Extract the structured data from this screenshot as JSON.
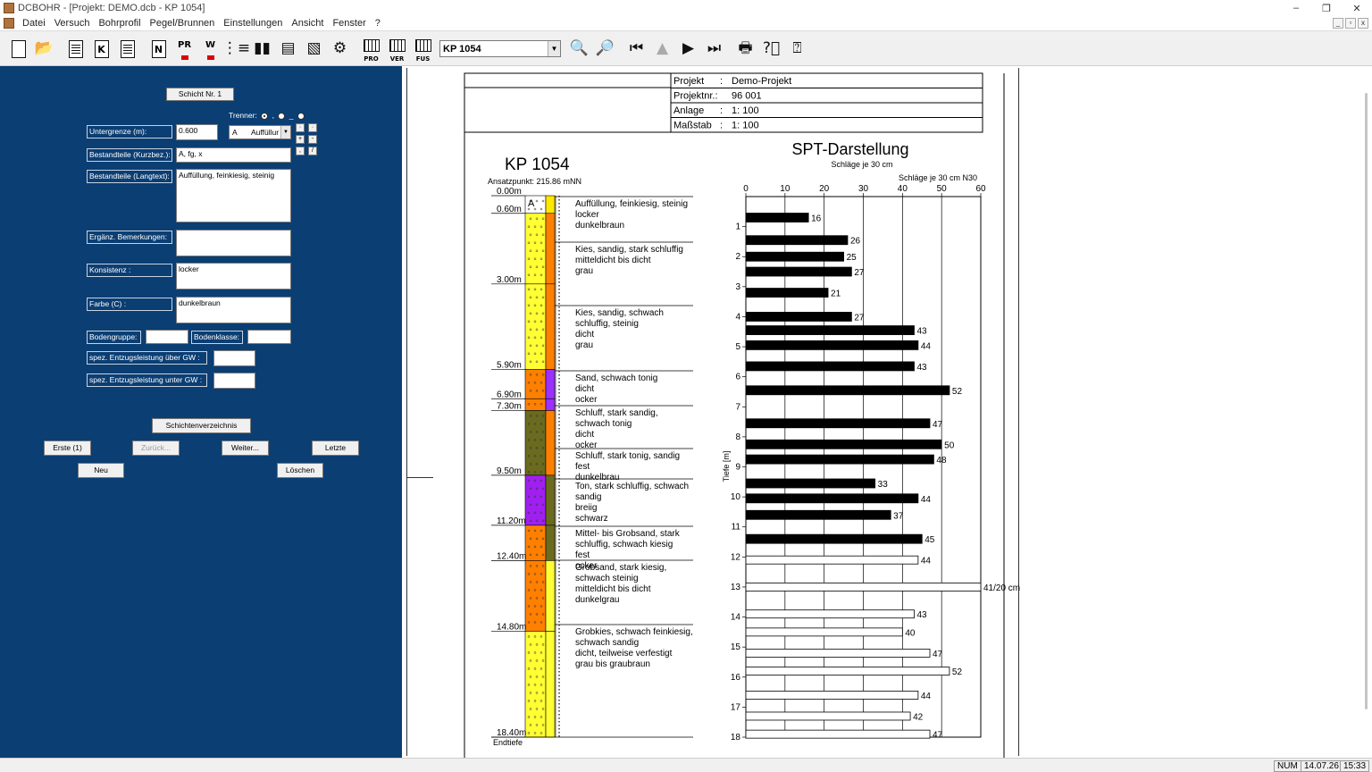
{
  "titlebar": {
    "title": "DCBOHR - [Projekt: DEMO.dcb - KP 1054]",
    "minimize": "–",
    "maximize": "❐",
    "close": "✕"
  },
  "menu": [
    "Datei",
    "Versuch",
    "Bohrprofil",
    "Pegel/Brunnen",
    "Einstellungen",
    "Ansicht",
    "Fenster",
    "?"
  ],
  "mdi_buttons": [
    "_",
    "▫",
    "x"
  ],
  "toolbar": {
    "kp_combo": "KP 1054",
    "btn_pr": "PR",
    "btn_w": "W",
    "btn_n": "N",
    "btn_k": "K",
    "btn_pro": "PRO",
    "btn_ver": "VER",
    "btn_fus": "FUS"
  },
  "form": {
    "schicht_btn": "Schicht Nr.  1",
    "trenner_label": "Trenner:",
    "trenner_opts": [
      ",",
      "_"
    ],
    "untergrenze_label": "Untergrenze        (m):",
    "untergrenze_value": "0.600",
    "bodenart_code": "A",
    "bodenart_name": "Auffüllur",
    "mini_buttons": [
      "·",
      "+",
      "-",
      ",",
      "/",
      "·"
    ],
    "kurzbez_label": "Bestandteile (Kurzbez.):",
    "kurzbez_value": "A, fg, x",
    "langtext_label": "Bestandteile (Langtext):",
    "langtext_value": "Auffüllung, feinkiesig, steinig",
    "bemerkungen_label": "Ergänz. Bemerkungen:",
    "bemerkungen_value": "",
    "konsistenz_label": "Konsistenz           :",
    "konsistenz_value": "locker",
    "farbe_label": "Farbe (C)              :",
    "farbe_value": "dunkelbraun",
    "bodengruppe_label": "Bodengruppe:",
    "bodenklasse_label": "Bodenklasse:",
    "entzug_ueber_label": "spez. Entzugsleistung über GW :",
    "entzug_unter_label": "spez. Entzugsleistung unter GW :",
    "schichtenverzeichnis_btn": "Schichtenverzeichnis",
    "erste_btn": "Erste (1)",
    "zurueck_btn": "Zurück...",
    "weiter_btn": "Weiter...",
    "letzte_btn": "Letzte",
    "neu_btn": "Neu",
    "loeschen_btn": "Löschen"
  },
  "header_table": {
    "rows": [
      {
        "label": "Projekt",
        "sep": ":",
        "value": "Demo-Projekt"
      },
      {
        "label": "Projektnr.:",
        "sep": "",
        "value": "96 001"
      },
      {
        "label": "Anlage",
        "sep": ":",
        "value": "1: 100"
      },
      {
        "label": "Maßstab",
        "sep": ":",
        "value": "1: 100"
      }
    ]
  },
  "profile": {
    "title": "KP 1054",
    "ansatzpunkt": "Ansatzpunkt: 215.86 mNN",
    "endtiefe": "Endtiefe",
    "layer_code_first": "A",
    "depth_labels": [
      {
        "text": "0.00m",
        "depth": 0.0
      },
      {
        "text": "0.60m",
        "depth": 0.6
      },
      {
        "text": "3.00m",
        "depth": 3.0
      },
      {
        "text": "5.90m",
        "depth": 5.9
      },
      {
        "text": "6.90m",
        "depth": 6.9
      },
      {
        "text": "7.30m",
        "depth": 7.3
      },
      {
        "text": "9.50m",
        "depth": 9.5
      },
      {
        "text": "11.20m",
        "depth": 11.2
      },
      {
        "text": "12.40m",
        "depth": 12.4
      },
      {
        "text": "14.80m",
        "depth": 14.8
      },
      {
        "text": "18.40m",
        "depth": 18.4
      }
    ],
    "layers": [
      {
        "top": 0.0,
        "bottom": 0.6,
        "color": "#ffffff",
        "stripe": "#ffe800",
        "lines": [
          "Auffüllung, feinkiesig, steinig",
          "locker",
          "dunkelbraun"
        ]
      },
      {
        "top": 0.6,
        "bottom": 3.0,
        "color": "#ffff33",
        "stripe": "#ff8000",
        "lines": [
          "Kies, sandig, stark schluffig",
          "mitteldicht bis dicht",
          "grau"
        ]
      },
      {
        "top": 3.0,
        "bottom": 5.9,
        "color": "#ffff33",
        "stripe": "#ff8000",
        "lines": [
          "Kies, sandig, schwach",
          "schluffig, steinig",
          "dicht",
          "grau"
        ]
      },
      {
        "top": 5.9,
        "bottom": 6.9,
        "color": "#ff8000",
        "stripe": "#9b30ff",
        "lines": [
          "Sand, schwach tonig",
          "dicht",
          "ocker"
        ]
      },
      {
        "top": 6.9,
        "bottom": 7.3,
        "color": "#ff8000",
        "stripe": "#9b30ff",
        "lines": []
      },
      {
        "top": 7.3,
        "bottom": 9.5,
        "color": "#6b6b1f",
        "stripe": "#ff8000",
        "lines": [
          "Schluff, stark sandig,",
          "schwach tonig",
          "dicht",
          "ocker"
        ]
      },
      {
        "top": 9.5,
        "bottom": 9.5,
        "color": "#6b6b1f",
        "stripe": "#9b30ff",
        "lines": [
          "Schluff, stark tonig, sandig",
          "fest",
          "dunkelbrau"
        ]
      },
      {
        "top": 9.5,
        "bottom": 11.2,
        "color": "#a020f0",
        "stripe": "#6b6b1f",
        "lines": [
          "Ton, stark schluffig, schwach",
          "sandig",
          "breiig",
          "schwarz"
        ]
      },
      {
        "top": 11.2,
        "bottom": 12.4,
        "color": "#ff8000",
        "stripe": "#6b6b1f",
        "lines": [
          "Mittel-  bis Grobsand, stark",
          "schluffig, schwach kiesig",
          "fest",
          "ocker"
        ]
      },
      {
        "top": 12.4,
        "bottom": 14.8,
        "color": "#ff8000",
        "stripe": "#ffff33",
        "lines": [
          "Grobsand, stark kiesig,",
          "schwach steinig",
          "mitteldicht bis dicht",
          "dunkelgrau"
        ]
      },
      {
        "top": 14.8,
        "bottom": 18.4,
        "color": "#ffff33",
        "stripe": "#ffff33",
        "lines": [
          "Grobkies, schwach feinkiesig,",
          "schwach sandig",
          "dicht, teilweise verfestigt",
          "grau bis graubraun"
        ]
      }
    ]
  },
  "chart_data": {
    "type": "bar",
    "title": "SPT-Darstellung",
    "subtitle": "Schläge je 30 cm",
    "xlabel": "Schläge je 30 cm N30",
    "ylabel": "Tiefe [m]",
    "xlim": [
      0,
      60
    ],
    "ylim": [
      0,
      18
    ],
    "x_ticks": [
      0,
      10,
      20,
      30,
      40,
      50,
      60
    ],
    "y_ticks": [
      1,
      2,
      3,
      4,
      5,
      6,
      7,
      8,
      9,
      10,
      11,
      12,
      13,
      14,
      15,
      16,
      17,
      18
    ],
    "orientation": "horizontal",
    "bars": [
      {
        "depth": 0.7,
        "value": 16,
        "label": "16",
        "filled": true
      },
      {
        "depth": 1.45,
        "value": 26,
        "label": "26",
        "filled": true
      },
      {
        "depth": 2.0,
        "value": 25,
        "label": "25",
        "filled": true
      },
      {
        "depth": 2.5,
        "value": 27,
        "label": "27",
        "filled": true
      },
      {
        "depth": 3.2,
        "value": 21,
        "label": "21",
        "filled": true
      },
      {
        "depth": 4.0,
        "value": 27,
        "label": "27",
        "filled": true
      },
      {
        "depth": 4.45,
        "value": 43,
        "label": "43",
        "filled": true
      },
      {
        "depth": 4.95,
        "value": 44,
        "label": "44",
        "filled": true
      },
      {
        "depth": 5.65,
        "value": 43,
        "label": "43",
        "filled": true
      },
      {
        "depth": 6.45,
        "value": 52,
        "label": "52",
        "filled": true
      },
      {
        "depth": 7.55,
        "value": 47,
        "label": "47",
        "filled": true
      },
      {
        "depth": 8.25,
        "value": 50,
        "label": "50",
        "filled": true
      },
      {
        "depth": 8.75,
        "value": 48,
        "label": "48",
        "filled": true
      },
      {
        "depth": 9.55,
        "value": 33,
        "label": "33",
        "filled": true
      },
      {
        "depth": 10.05,
        "value": 44,
        "label": "44",
        "filled": true
      },
      {
        "depth": 10.6,
        "value": 37,
        "label": "37",
        "filled": true
      },
      {
        "depth": 11.4,
        "value": 45,
        "label": "45",
        "filled": true
      },
      {
        "depth": 12.1,
        "value": 44,
        "label": "44",
        "filled": false
      },
      {
        "depth": 13.0,
        "value": 60,
        "label": "41/20 cm",
        "filled": false
      },
      {
        "depth": 13.9,
        "value": 43,
        "label": "43",
        "filled": false
      },
      {
        "depth": 14.5,
        "value": 40,
        "label": "40",
        "filled": false
      },
      {
        "depth": 15.2,
        "value": 47,
        "label": "47",
        "filled": false
      },
      {
        "depth": 15.8,
        "value": 52,
        "label": "52",
        "filled": false
      },
      {
        "depth": 16.6,
        "value": 44,
        "label": "44",
        "filled": false
      },
      {
        "depth": 17.3,
        "value": 42,
        "label": "42",
        "filled": false
      },
      {
        "depth": 17.9,
        "value": 47,
        "label": "47",
        "filled": false
      }
    ]
  },
  "status": {
    "num": "NUM",
    "date": "14.07.26",
    "time": "15:33"
  }
}
